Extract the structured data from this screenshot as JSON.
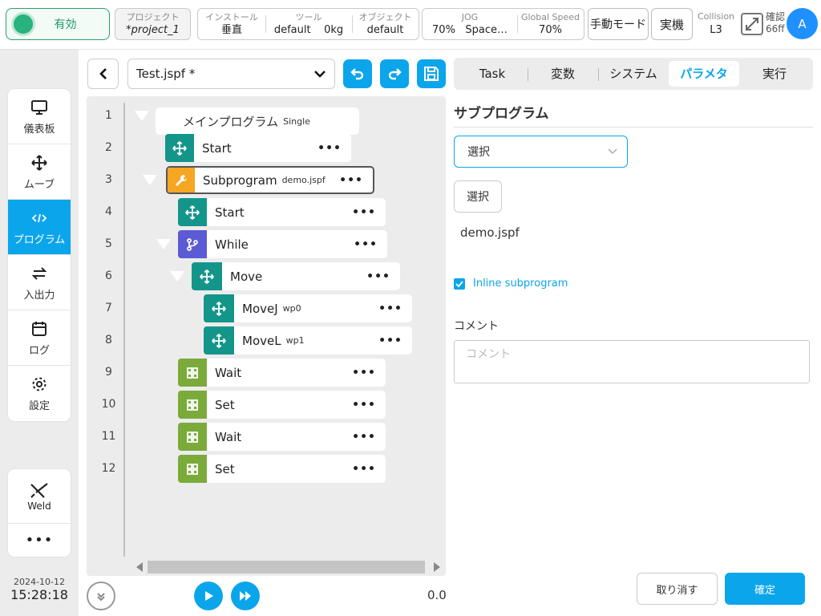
{
  "header": {
    "status": "有効",
    "project": {
      "label": "プロジェクト",
      "value": "*project_1"
    },
    "install": {
      "label": "インストール",
      "value": "垂直"
    },
    "tool": {
      "label": "ツール",
      "value": "default",
      "weight": "0kg"
    },
    "object": {
      "label": "オブジェクト",
      "value": "default"
    },
    "jog": {
      "label": "JOG",
      "value": "70%",
      "space": "Space…"
    },
    "global_speed": {
      "label": "Global Speed",
      "value": "70%"
    },
    "manual_mode": "手動モード",
    "real_machine": "実機",
    "collision": {
      "label": "Collision",
      "value": "L3"
    },
    "confirm": {
      "label": "確認",
      "value": "66ff"
    },
    "avatar": "A"
  },
  "nav": {
    "items": [
      {
        "label": "儀表板",
        "icon": "monitor-icon"
      },
      {
        "label": "ムーブ",
        "icon": "move-arrows-icon"
      },
      {
        "label": "プログラム",
        "icon": "code-icon",
        "active": true
      },
      {
        "label": "入出力",
        "icon": "swap-icon"
      },
      {
        "label": "ログ",
        "icon": "calendar-icon"
      },
      {
        "label": "設定",
        "icon": "gear-icon"
      }
    ],
    "weld": "Weld",
    "more": "•••",
    "date": "2024-10-12",
    "time": "15:28:18"
  },
  "program": {
    "file": "Test.jspf *",
    "rows": [
      {
        "num": "1",
        "name": "メインプログラム",
        "sub": "Single",
        "type": "main"
      },
      {
        "num": "2",
        "name": "Start",
        "sub": "",
        "type": "move"
      },
      {
        "num": "3",
        "name": "Subprogram",
        "sub": "demo.jspf",
        "type": "subprogram",
        "selected": true
      },
      {
        "num": "4",
        "name": "Start",
        "sub": "",
        "type": "move"
      },
      {
        "num": "5",
        "name": "While",
        "sub": "",
        "type": "while"
      },
      {
        "num": "6",
        "name": "Move",
        "sub": "",
        "type": "move"
      },
      {
        "num": "7",
        "name": "MoveJ",
        "sub": "wp0",
        "type": "move"
      },
      {
        "num": "8",
        "name": "MoveL",
        "sub": "wp1",
        "type": "move"
      },
      {
        "num": "9",
        "name": "Wait",
        "sub": "",
        "type": "logic"
      },
      {
        "num": "10",
        "name": "Set",
        "sub": "",
        "type": "logic"
      },
      {
        "num": "11",
        "name": "Wait",
        "sub": "",
        "type": "logic"
      },
      {
        "num": "12",
        "name": "Set",
        "sub": "",
        "type": "logic"
      }
    ],
    "more_label": "•••",
    "speed": "0.0"
  },
  "tabs": [
    "Task",
    "変数",
    "システム",
    "パラメタ",
    "実行"
  ],
  "active_tab": "パラメタ",
  "panel": {
    "title": "サブプログラム",
    "dropdown": "選択",
    "select_button": "選択",
    "filename": "demo.jspf",
    "inline_label": "Inline subprogram",
    "inline_checked": true,
    "comment_label": "コメント",
    "comment_placeholder": "コメント",
    "comment_value": "",
    "cancel": "取り消す",
    "ok": "確定"
  },
  "colors": {
    "accent": "#0ba5ec",
    "move": "#14958a",
    "subprogram": "#f5a623",
    "while": "#5b5bd6",
    "logic": "#7aab3a",
    "status": "#29b27a"
  }
}
